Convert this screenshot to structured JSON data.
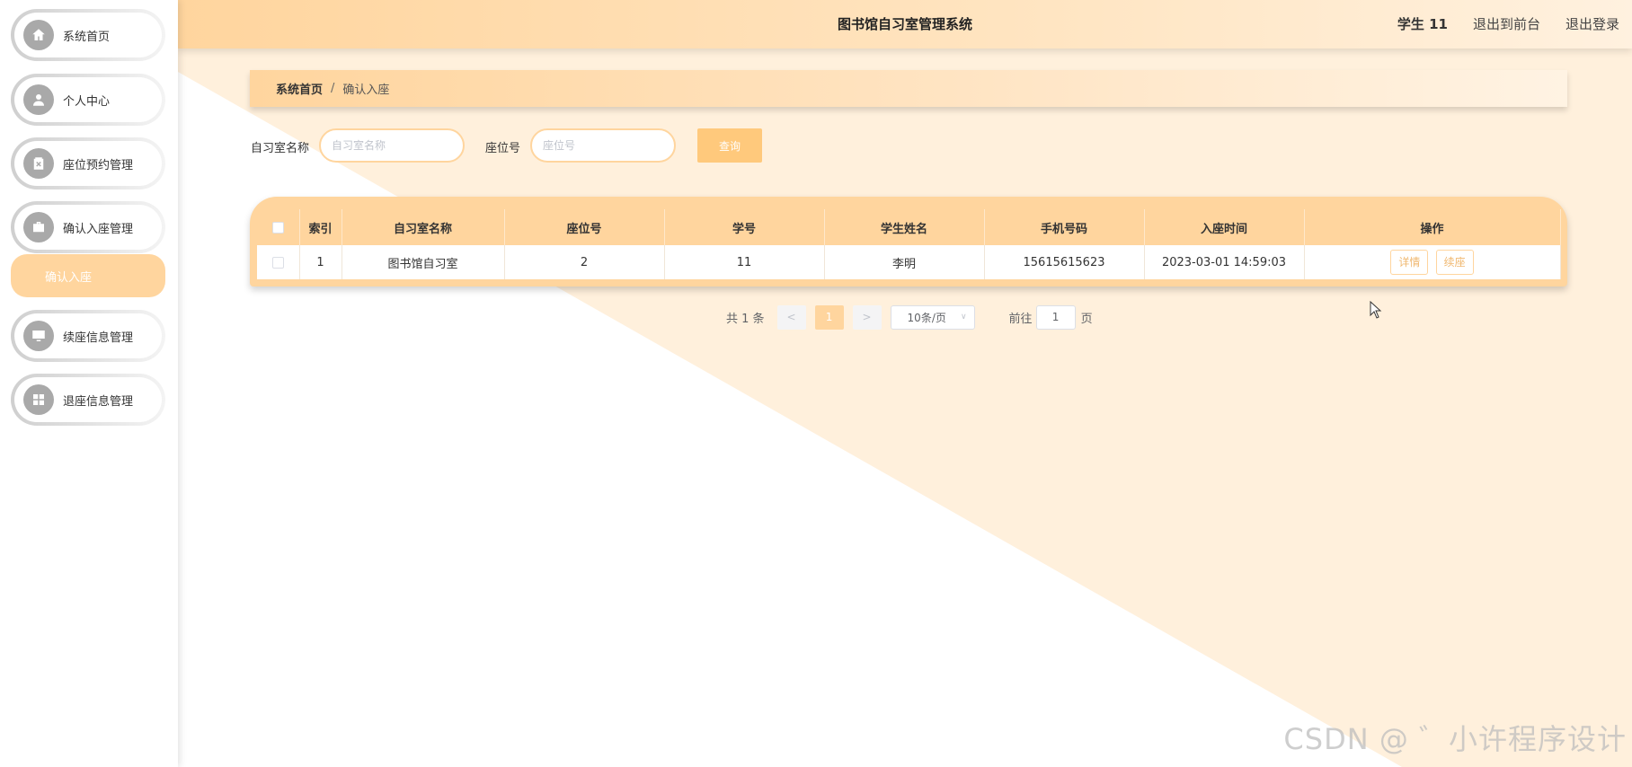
{
  "app": {
    "title": "图书馆自习室管理系统",
    "user": "学生 11",
    "exit_front": "退出到前台",
    "logout": "退出登录"
  },
  "sidebar": {
    "items": [
      {
        "label": "系统首页",
        "icon": "home-icon"
      },
      {
        "label": "个人中心",
        "icon": "user-icon"
      },
      {
        "label": "座位预约管理",
        "icon": "clipboard-icon"
      },
      {
        "label": "确认入座管理",
        "icon": "briefcase-icon"
      },
      {
        "label": "续座信息管理",
        "icon": "monitor-icon"
      },
      {
        "label": "退座信息管理",
        "icon": "grid-icon"
      }
    ],
    "submenu": {
      "label": "确认入座"
    }
  },
  "breadcrumb": {
    "home": "系统首页",
    "separator": "/",
    "current": "确认入座"
  },
  "search": {
    "room_label": "自习室名称",
    "room_placeholder": "自习室名称",
    "seat_label": "座位号",
    "seat_placeholder": "座位号",
    "query_button": "查询"
  },
  "table": {
    "headers": [
      "索引",
      "自习室名称",
      "座位号",
      "学号",
      "学生姓名",
      "手机号码",
      "入座时间",
      "操作"
    ],
    "rows": [
      {
        "index": "1",
        "room": "图书馆自习室",
        "seat": "2",
        "student_id": "11",
        "name": "李明",
        "phone": "15615615623",
        "time": "2023-03-01 14:59:03",
        "detail": "详情",
        "renew": "续座"
      }
    ]
  },
  "pagination": {
    "total": "共 1 条",
    "prev": "<",
    "page": "1",
    "next": ">",
    "page_size": "10条/页",
    "goto_label": "前往",
    "goto_value": "1",
    "page_unit": "页"
  },
  "watermark": "CSDN @ ゛小许程序设计",
  "colors": {
    "accent": "#ffd59e",
    "button": "#ffc97c",
    "background_tint": "#fff1df"
  }
}
